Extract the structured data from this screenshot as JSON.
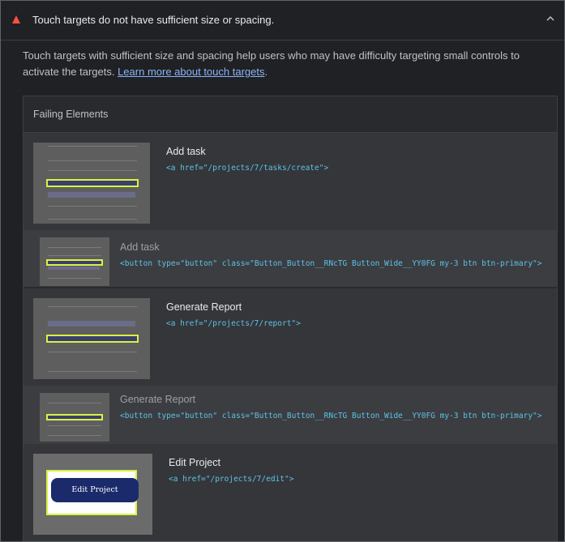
{
  "audit": {
    "title": "Touch targets do not have sufficient size or spacing.",
    "description_before": "Touch targets with sufficient size and spacing help users who may have difficulty targeting small controls to activate the targets.",
    "learn_more_link": "Learn more about touch targets",
    "description_after": "."
  },
  "failing": {
    "header": "Failing Elements",
    "items": [
      {
        "label": "Add task",
        "snippet": "<a href=\"/projects/7/tasks/create\">"
      },
      {
        "label": "Add task",
        "snippet": "<button type=\"button\" class=\"Button_Button__RNcTG Button_Wide__YY0FG my-3 btn btn-primary\">"
      },
      {
        "label": "Generate Report",
        "snippet": "<a href=\"/projects/7/report\">"
      },
      {
        "label": "Generate Report",
        "snippet": "<button type=\"button\" class=\"Button_Button__RNcTG Button_Wide__YY0FG my-3 btn btn-primary\">"
      },
      {
        "label": "Edit Project",
        "snippet": "<a href=\"/projects/7/edit\">",
        "thumb_button": "Edit Project"
      }
    ]
  },
  "icons": {
    "warning": "warning-triangle-icon",
    "collapse": "chevron-up-icon"
  },
  "colors": {
    "warning": "#ff4e42",
    "link": "#8ab4f8",
    "code": "#5cc2e6",
    "highlight": "#d9f241"
  }
}
